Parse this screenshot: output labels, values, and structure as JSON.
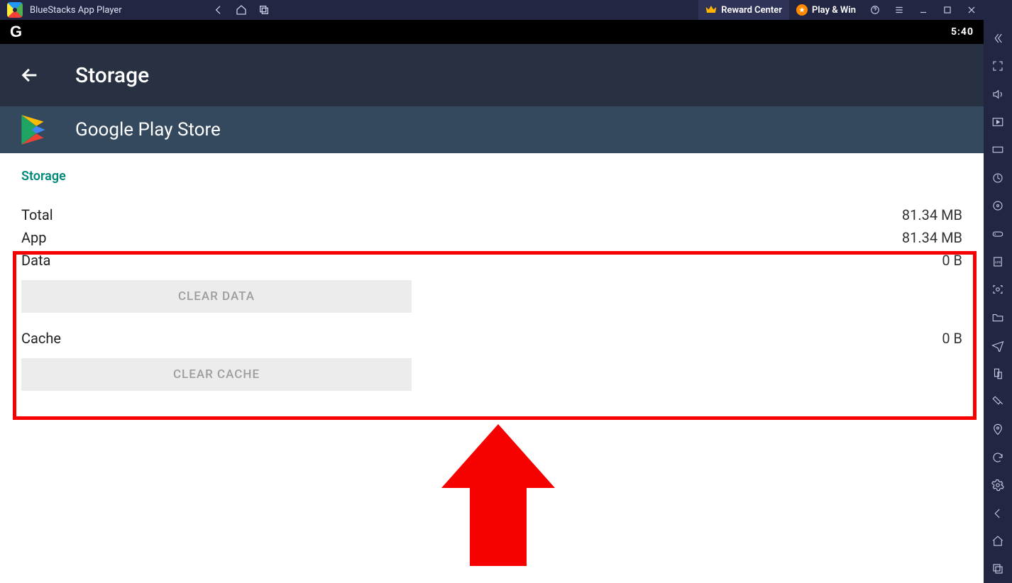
{
  "titlebar": {
    "app_name": "BlueStacks App Player",
    "reward_label": "Reward Center",
    "playwin_label": "Play & Win"
  },
  "android": {
    "status_brand": "G",
    "clock": "5:40"
  },
  "settings": {
    "title": "Storage"
  },
  "app": {
    "name": "Google Play Store"
  },
  "storage": {
    "section": "Storage",
    "total": {
      "label": "Total",
      "value": "81.34 MB"
    },
    "app": {
      "label": "App",
      "value": "81.34 MB"
    },
    "data": {
      "label": "Data",
      "value": "0 B",
      "button": "CLEAR DATA"
    },
    "cache": {
      "label": "Cache",
      "value": "0 B",
      "button": "CLEAR CACHE"
    }
  },
  "side_icons": [
    "collapse-icon",
    "fullscreen-icon",
    "volume-icon",
    "media-folder-icon",
    "keyboard-shortcut-icon",
    "sync-icon",
    "location-lock-icon",
    "game-controller-icon",
    "install-apk-icon",
    "screenshot-icon",
    "folder-icon",
    "airplane-icon",
    "device-icon",
    "shake-icon",
    "map-pin-icon",
    "rotate-icon"
  ],
  "bottom_icons": [
    "settings-icon",
    "back-icon",
    "home-icon",
    "recents-icon"
  ]
}
